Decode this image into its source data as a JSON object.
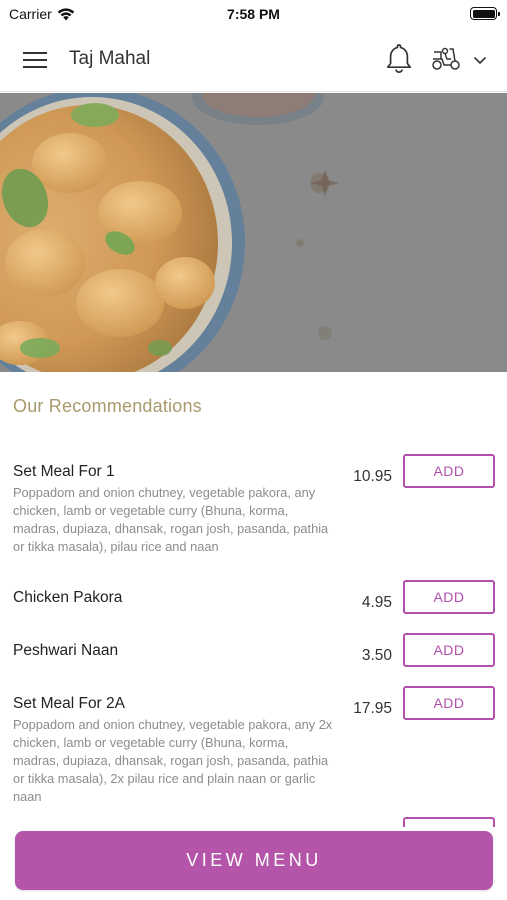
{
  "status_bar": {
    "carrier": "Carrier",
    "time": "7:58 PM"
  },
  "header": {
    "title": "Taj Mahal"
  },
  "icons": {
    "menu": "hamburger-menu-icon",
    "bell": "bell-icon",
    "delivery": "scooter-icon",
    "chevron": "chevron-down-icon",
    "wifi": "wifi-icon",
    "battery": "battery-icon"
  },
  "colors": {
    "accent": "#b455aa",
    "section_title": "#a89a6c",
    "description": "#8c8c8c"
  },
  "recommendations": {
    "title": "Our Recommendations",
    "items": [
      {
        "name": "Set Meal For 1",
        "description": "Poppadom and onion chutney, vegetable pakora, any chicken, lamb or vegetable curry (Bhuna, korma, madras, dupiaza, dhansak, rogan josh, pasanda, pathia or tikka masala), pilau rice and naan",
        "price": "10.95",
        "button": "ADD"
      },
      {
        "name": "Chicken Pakora",
        "description": "",
        "price": "4.95",
        "button": "ADD"
      },
      {
        "name": "Peshwari Naan",
        "description": "",
        "price": "3.50",
        "button": "ADD"
      },
      {
        "name": "Set Meal For 2A",
        "description": "Poppadom and onion chutney, vegetable pakora, any 2x chicken, lamb or vegetable curry (Bhuna, korma, madras, dupiaza, dhansak, rogan josh, pasanda, pathia or tikka masala), 2x pilau rice and plain naan or garlic naan",
        "price": "17.95",
        "button": "ADD"
      }
    ]
  },
  "footer": {
    "view_menu": "VIEW MENU"
  }
}
